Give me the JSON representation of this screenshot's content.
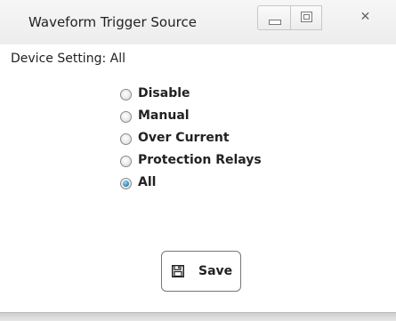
{
  "window": {
    "title": "Waveform Trigger Source"
  },
  "device_setting": {
    "text": "Device Setting: All"
  },
  "trigger_options": [
    {
      "label": "Disable",
      "checked": false
    },
    {
      "label": "Manual",
      "checked": false
    },
    {
      "label": "Over Current",
      "checked": false
    },
    {
      "label": "Protection Relays",
      "checked": false
    },
    {
      "label": "All",
      "checked": true
    }
  ],
  "save_button": {
    "label": "Save",
    "icon": "floppy-disk-icon"
  }
}
